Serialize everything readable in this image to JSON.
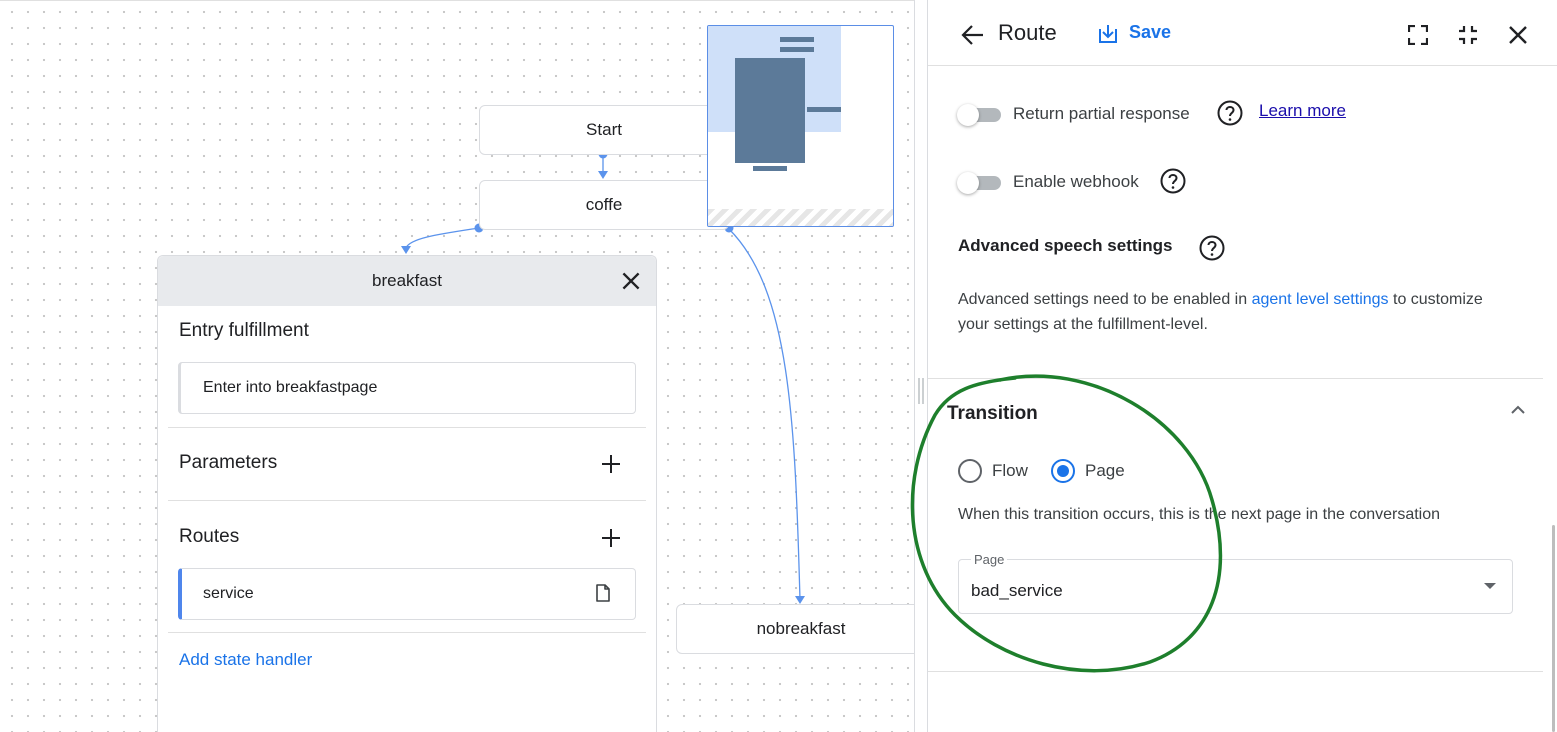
{
  "canvas": {
    "nodes": {
      "start": "Start",
      "coffe": "coffe",
      "nobreakfast": "nobreakfast"
    }
  },
  "page_panel": {
    "title": "breakfast",
    "entry_fulfillment_title": "Entry fulfillment",
    "entry_fulfillment_value": "Enter into breakfastpage",
    "parameters_title": "Parameters",
    "routes_title": "Routes",
    "route_item": "service",
    "add_state_handler": "Add state handler"
  },
  "route_panel": {
    "title": "Route",
    "save_label": "Save",
    "return_partial_response_label": "Return partial response",
    "learn_more": "Learn more",
    "enable_webhook_label": "Enable webhook",
    "advanced_speech_title": "Advanced speech settings",
    "advanced_text_before": "Advanced settings need to be enabled in ",
    "advanced_link": "agent level settings",
    "advanced_text_after": " to customize your settings at the fulfillment-level.",
    "transition": {
      "title": "Transition",
      "options": [
        "Flow",
        "Page"
      ],
      "selected": "Page",
      "description": "When this transition occurs, this is the next page in the conversation",
      "field_label": "Page",
      "field_value": "bad_service"
    }
  },
  "colors": {
    "accent": "#1a73e8",
    "annotation_circle": "#1e7f2c",
    "edge": "#5b93ec"
  }
}
